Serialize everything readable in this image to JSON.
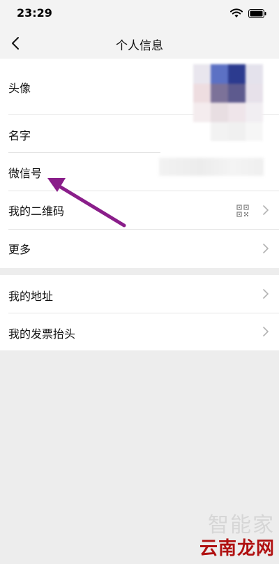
{
  "status_bar": {
    "time": "23:29"
  },
  "nav": {
    "title": "个人信息"
  },
  "profile_items": [
    {
      "label": "头像"
    },
    {
      "label": "名字"
    },
    {
      "label": "微信号"
    },
    {
      "label": "我的二维码"
    },
    {
      "label": "更多"
    }
  ],
  "other_items": [
    {
      "label": "我的地址"
    },
    {
      "label": "我的发票抬头"
    }
  ],
  "watermark": {
    "top": "智能家",
    "bottom": "云南龙网"
  },
  "colors": {
    "arrow": "#8a1e8a",
    "background": "#ededed",
    "watermark_red": "#b01010"
  }
}
